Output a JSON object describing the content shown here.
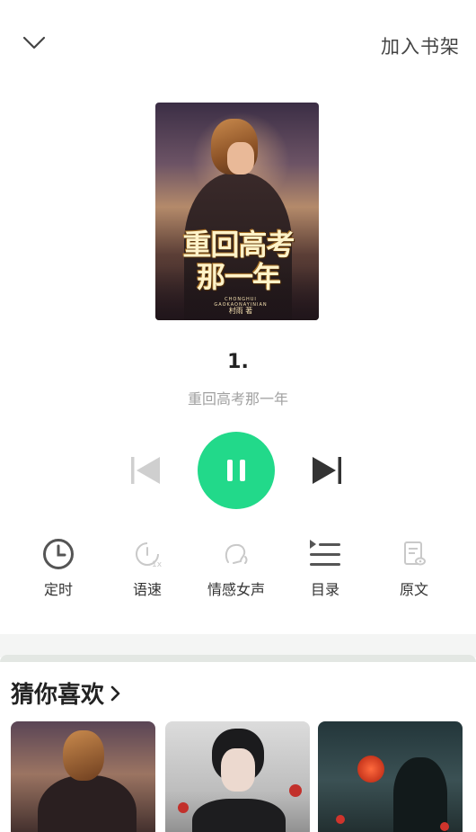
{
  "header": {
    "add_to_shelf": "加入书架"
  },
  "book": {
    "cover_title_line1": "重回高考",
    "cover_title_line2": "那一年",
    "cover_pinyin": "CHONGHUI GAOKAONAYINIAN",
    "cover_author": "村雨 著",
    "chapter": "1.",
    "name": "重回高考那一年"
  },
  "player": {
    "state": "playing"
  },
  "tools": [
    {
      "label": "定时",
      "icon": "timer-icon"
    },
    {
      "label": "语速",
      "icon": "speed-icon"
    },
    {
      "label": "情感女声",
      "icon": "voice-icon"
    },
    {
      "label": "目录",
      "icon": "catalog-icon"
    },
    {
      "label": "原文",
      "icon": "original-text-icon"
    }
  ],
  "recommend": {
    "title": "猜你喜欢"
  },
  "colors": {
    "accent": "#22d98a"
  }
}
